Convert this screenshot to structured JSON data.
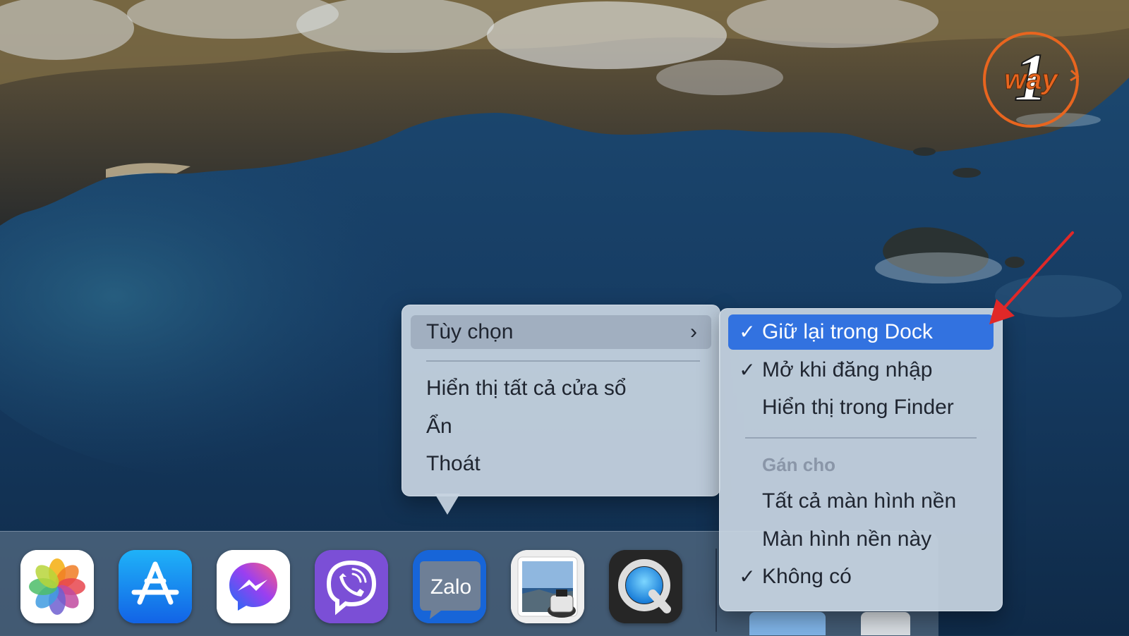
{
  "logo": {
    "text": "way",
    "number": "1"
  },
  "context_menu": {
    "options_label": "Tùy chọn",
    "options_chevron": "›",
    "show_all_windows": "Hiển thị tất cả cửa sổ",
    "hide": "Ẩn",
    "quit": "Thoát"
  },
  "submenu": {
    "keep_in_dock": "Giữ lại trong Dock",
    "open_at_login": "Mở khi đăng nhập",
    "show_in_finder": "Hiển thị trong Finder",
    "assign_to_header": "Gán cho",
    "all_desktops": "Tất cả màn hình nền",
    "this_desktop": "Màn hình nền này",
    "none": "Không có",
    "checkmark": "✓"
  },
  "dock": {
    "apps": [
      {
        "name": "Photos",
        "icon": "photos-icon"
      },
      {
        "name": "App Store",
        "icon": "app-store-icon"
      },
      {
        "name": "Messenger",
        "icon": "messenger-icon"
      },
      {
        "name": "Viber",
        "icon": "viber-icon"
      },
      {
        "name": "Zalo",
        "icon": "zalo-icon",
        "label": "Zalo"
      },
      {
        "name": "Preview",
        "icon": "preview-icon"
      },
      {
        "name": "QuickTime Player",
        "icon": "quicktime-icon"
      }
    ]
  },
  "colors": {
    "selection": "#3272e0",
    "menu_bg": "#c7d4e1",
    "logo_orange": "#e8651f",
    "arrow_red": "#e02828"
  }
}
